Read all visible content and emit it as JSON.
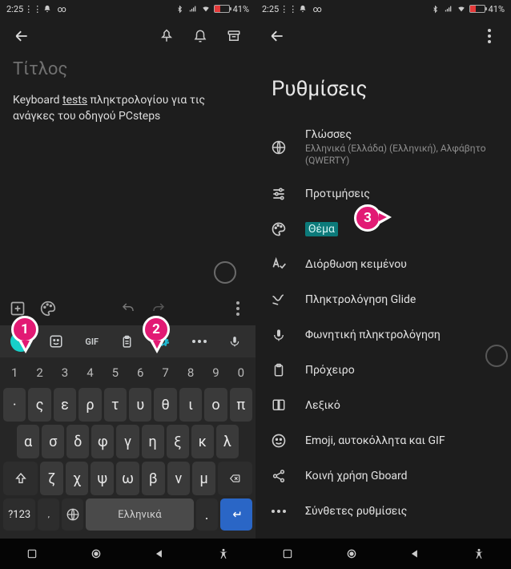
{
  "status": {
    "time": "2:25",
    "battery_pct": "41%"
  },
  "left": {
    "title_placeholder": "Τίτλος",
    "body_part1": "Keyboard ",
    "body_underlined": "tests",
    "body_part2": " πληκτρολογίου για τις ανάγκες του οδηγού PCsteps",
    "kbd_toolbar": {
      "gif_label": "GIF"
    },
    "keys": {
      "num": [
        "1",
        "2",
        "3",
        "4",
        "5",
        "6",
        "7",
        "8",
        "9",
        "0"
      ],
      "row1": [
        "·",
        "ς",
        "ε",
        "ρ",
        "τ",
        "υ",
        "θ",
        "ι",
        "ο",
        "π"
      ],
      "row2": [
        "α",
        "σ",
        "δ",
        "φ",
        "γ",
        "η",
        "ξ",
        "κ",
        "λ"
      ],
      "row3": [
        "ζ",
        "χ",
        "ψ",
        "ω",
        "β",
        "ν",
        "μ"
      ],
      "sym_key": "?123",
      "space_label": "Ελληνικά"
    }
  },
  "right": {
    "page_title": "Ρυθμίσεις",
    "items": [
      {
        "title": "Γλώσσες",
        "sub": "Ελληνικά (Ελλάδα) (Ελληνική), Αλφάβητο (QWERTY)"
      },
      {
        "title": "Προτιμήσεις"
      },
      {
        "title": "Θέμα",
        "highlight": true
      },
      {
        "title": "Διόρθωση κειμένου"
      },
      {
        "title": "Πληκτρολόγηση Glide"
      },
      {
        "title": "Φωνητική πληκτρολόγηση"
      },
      {
        "title": "Πρόχειρο"
      },
      {
        "title": "Λεξικό"
      },
      {
        "title": "Emoji, αυτοκόλλητα και GIF"
      },
      {
        "title": "Κοινή χρήση Gboard"
      },
      {
        "title": "Σύνθετες ρυθμίσεις"
      }
    ]
  },
  "callouts": {
    "c1": "1",
    "c2": "2",
    "c3": "3"
  }
}
